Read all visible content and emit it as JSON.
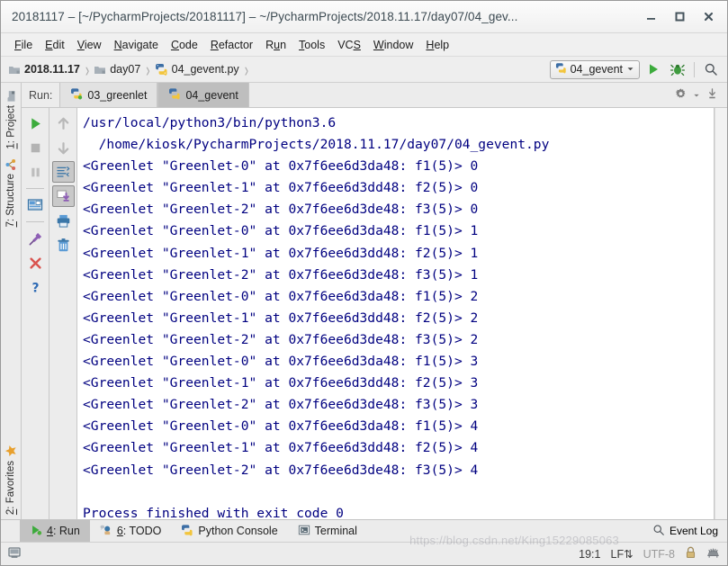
{
  "window": {
    "title": "20181117 – [~/PycharmProjects/20181117] – ~/PycharmProjects/2018.11.17/day07/04_gev...",
    "minimize_label": "–",
    "maximize_label": "□",
    "close_label": "✕"
  },
  "menubar": {
    "items": [
      {
        "label": "File",
        "mnemonic": "F"
      },
      {
        "label": "Edit",
        "mnemonic": "E"
      },
      {
        "label": "View",
        "mnemonic": "V"
      },
      {
        "label": "Navigate",
        "mnemonic": "N"
      },
      {
        "label": "Code",
        "mnemonic": "C"
      },
      {
        "label": "Refactor",
        "mnemonic": "R"
      },
      {
        "label": "Run",
        "mnemonic": "u"
      },
      {
        "label": "Tools",
        "mnemonic": "T"
      },
      {
        "label": "VCS",
        "mnemonic": "S"
      },
      {
        "label": "Window",
        "mnemonic": "W"
      },
      {
        "label": "Help",
        "mnemonic": "H"
      }
    ]
  },
  "navbar": {
    "breadcrumbs": [
      {
        "label": "2018.11.17",
        "icon": "folder-icon",
        "bold": true
      },
      {
        "label": "day07",
        "icon": "folder-icon",
        "bold": false
      },
      {
        "label": "04_gevent.py",
        "icon": "python-file-icon",
        "bold": false
      }
    ],
    "separator": "❯",
    "run_config": "04_gevent",
    "run_config_icon": "python-icon",
    "dropdown_icon": "chevron-down-icon",
    "run_icon": "run-icon",
    "debug_icon": "debug-bug-icon",
    "search_icon": "search-icon"
  },
  "left_stripe": {
    "top_items": [
      {
        "label": "1: Project",
        "mnemonic": "1",
        "icon": "project-folder-icon"
      },
      {
        "label": "7: Structure",
        "mnemonic": "7",
        "icon": "structure-icon"
      }
    ],
    "bottom_items": [
      {
        "label": "2: Favorites",
        "mnemonic": "2",
        "icon": "star-icon"
      }
    ]
  },
  "run_window": {
    "label": "Run:",
    "tabs": [
      {
        "label": "03_greenlet",
        "icon": "python-run-icon",
        "active": false
      },
      {
        "label": "04_gevent",
        "icon": "python-run-icon",
        "active": true
      }
    ],
    "settings_icon": "gear-icon",
    "settings_dropdown_icon": "chevron-down-icon",
    "hide_icon": "hide-window-icon",
    "left_toolbar": [
      {
        "name": "rerun-icon",
        "enabled": true
      },
      {
        "name": "stop-icon",
        "enabled": false
      },
      {
        "name": "pause-icon",
        "enabled": false
      },
      {
        "name": "restore-layout-icon",
        "enabled": true
      },
      {
        "name": "pin-tab-icon",
        "enabled": true
      },
      {
        "name": "close-icon",
        "enabled": true
      },
      {
        "name": "help-icon",
        "enabled": true
      }
    ],
    "right_toolbar": [
      {
        "name": "scroll-up-icon",
        "enabled": false
      },
      {
        "name": "scroll-down-icon",
        "enabled": false
      },
      {
        "name": "soft-wrap-icon",
        "enabled": true,
        "framed": true
      },
      {
        "name": "scroll-to-end-icon",
        "enabled": true,
        "framed": true
      },
      {
        "name": "print-icon",
        "enabled": true
      },
      {
        "name": "clear-all-icon",
        "enabled": true
      }
    ]
  },
  "console": {
    "lines": [
      "/usr/local/python3/bin/python3.6",
      "  /home/kiosk/PycharmProjects/2018.11.17/day07/04_gevent.py",
      "<Greenlet \"Greenlet-0\" at 0x7f6ee6d3da48: f1(5)> 0",
      "<Greenlet \"Greenlet-1\" at 0x7f6ee6d3dd48: f2(5)> 0",
      "<Greenlet \"Greenlet-2\" at 0x7f6ee6d3de48: f3(5)> 0",
      "<Greenlet \"Greenlet-0\" at 0x7f6ee6d3da48: f1(5)> 1",
      "<Greenlet \"Greenlet-1\" at 0x7f6ee6d3dd48: f2(5)> 1",
      "<Greenlet \"Greenlet-2\" at 0x7f6ee6d3de48: f3(5)> 1",
      "<Greenlet \"Greenlet-0\" at 0x7f6ee6d3da48: f1(5)> 2",
      "<Greenlet \"Greenlet-1\" at 0x7f6ee6d3dd48: f2(5)> 2",
      "<Greenlet \"Greenlet-2\" at 0x7f6ee6d3de48: f3(5)> 2",
      "<Greenlet \"Greenlet-0\" at 0x7f6ee6d3da48: f1(5)> 3",
      "<Greenlet \"Greenlet-1\" at 0x7f6ee6d3dd48: f2(5)> 3",
      "<Greenlet \"Greenlet-2\" at 0x7f6ee6d3de48: f3(5)> 3",
      "<Greenlet \"Greenlet-0\" at 0x7f6ee6d3da48: f1(5)> 4",
      "<Greenlet \"Greenlet-1\" at 0x7f6ee6d3dd48: f2(5)> 4",
      "<Greenlet \"Greenlet-2\" at 0x7f6ee6d3de48: f3(5)> 4"
    ],
    "exit_line": "Process finished with exit code 0",
    "text_color": "#000080",
    "background": "#ffffff"
  },
  "bottom_bar": {
    "tabs": [
      {
        "label": "4: Run",
        "mnemonic": "4",
        "icon": "run-icon",
        "active": true
      },
      {
        "label": "6: TODO",
        "mnemonic": "6",
        "icon": "todo-icon",
        "active": false
      },
      {
        "label": "Python Console",
        "mnemonic": "",
        "icon": "python-icon",
        "active": false
      },
      {
        "label": "Terminal",
        "mnemonic": "",
        "icon": "terminal-icon",
        "active": false
      }
    ],
    "event_log": "Event Log",
    "event_log_icon": "search-icon"
  },
  "status_bar": {
    "memory_icon": "memory-indicator-icon",
    "caret_position": "19:1",
    "line_separator": "LF",
    "line_separator_icon": "updown-arrow-icon",
    "encoding": "UTF-8",
    "lock_icon": "lock-icon",
    "vcs_icon": "hedgehog-icon",
    "watermark": "https://blog.csdn.net/King15229085063"
  }
}
